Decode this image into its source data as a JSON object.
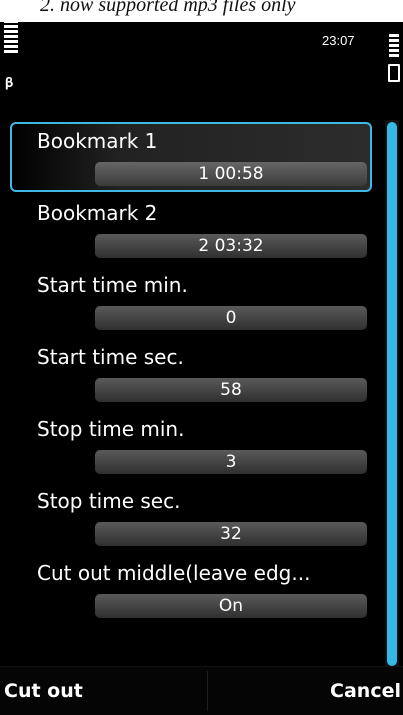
{
  "caption": "2. now supported mp3 files only",
  "status": {
    "time": "23:07",
    "signal_icon": "signal-strength-icon",
    "battery_icon": "battery-icon",
    "bluetooth_icon": "bluetooth-icon"
  },
  "list": {
    "items": [
      {
        "label": "Bookmark 1",
        "value": "1 00:58",
        "selected": true
      },
      {
        "label": "Bookmark 2",
        "value": "2 03:32"
      },
      {
        "label": "Start time min.",
        "value": "0"
      },
      {
        "label": "Start time sec.",
        "value": "58"
      },
      {
        "label": "Stop time min.",
        "value": "3"
      },
      {
        "label": "Stop time sec.",
        "value": "32"
      },
      {
        "label": "Cut out middle(leave edg...",
        "value": "On"
      }
    ]
  },
  "softkeys": {
    "left": "Cut out",
    "right": "Cancel"
  },
  "colors": {
    "accent": "#36b8e6",
    "background": "#000000"
  }
}
